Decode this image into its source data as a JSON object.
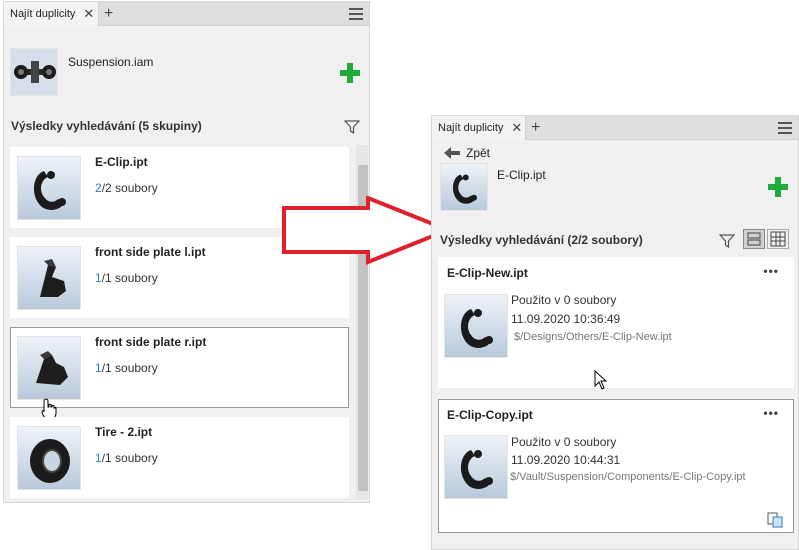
{
  "left_panel": {
    "tab_label": "Najít duplicity",
    "close_glyph": "✕",
    "add_tab_glyph": "+",
    "assembly_name": "Suspension.iam",
    "results_title": "Výsledky vyhledávání (5 skupiny)",
    "items": [
      {
        "name": "E-Clip.ipt",
        "count_num": "2",
        "count_rest": "/2 soubory",
        "icon": "eclip-thumbnail"
      },
      {
        "name": "front side plate l.ipt",
        "count_num": "1",
        "count_rest": "/1 soubory",
        "icon": "plate-thumbnail"
      },
      {
        "name": "front side plate r.ipt",
        "count_num": "1",
        "count_rest": "/1 soubory",
        "icon": "plate-thumbnail",
        "selected": true
      },
      {
        "name": "Tire - 2.ipt",
        "count_num": "1",
        "count_rest": "/1 soubory",
        "icon": "tire-thumbnail"
      }
    ]
  },
  "right_panel": {
    "tab_label": "Najít duplicity",
    "close_glyph": "✕",
    "add_tab_glyph": "+",
    "back_label": "Zpět",
    "selected_name": "E-Clip.ipt",
    "results_title": "Výsledky vyhledávání (2/2 soubory)",
    "more_glyph": "•••",
    "files": [
      {
        "name": "E-Clip-New.ipt",
        "used": "Použito v 0 soubory",
        "date": "11.09.2020 10:36:49",
        "path": "$/Designs/Others/E-Clip-New.ipt"
      },
      {
        "name": "E-Clip-Copy.ipt",
        "used": "Použito v 0 soubory",
        "date": "11.09.2020 10:44:31",
        "path": "$/Vault/Suspension/Components/E-Clip-Copy.ipt"
      }
    ]
  },
  "colors": {
    "accent_green": "#1faa3a",
    "link_blue": "#2f7ec2",
    "arrow_red": "#e0202a"
  }
}
